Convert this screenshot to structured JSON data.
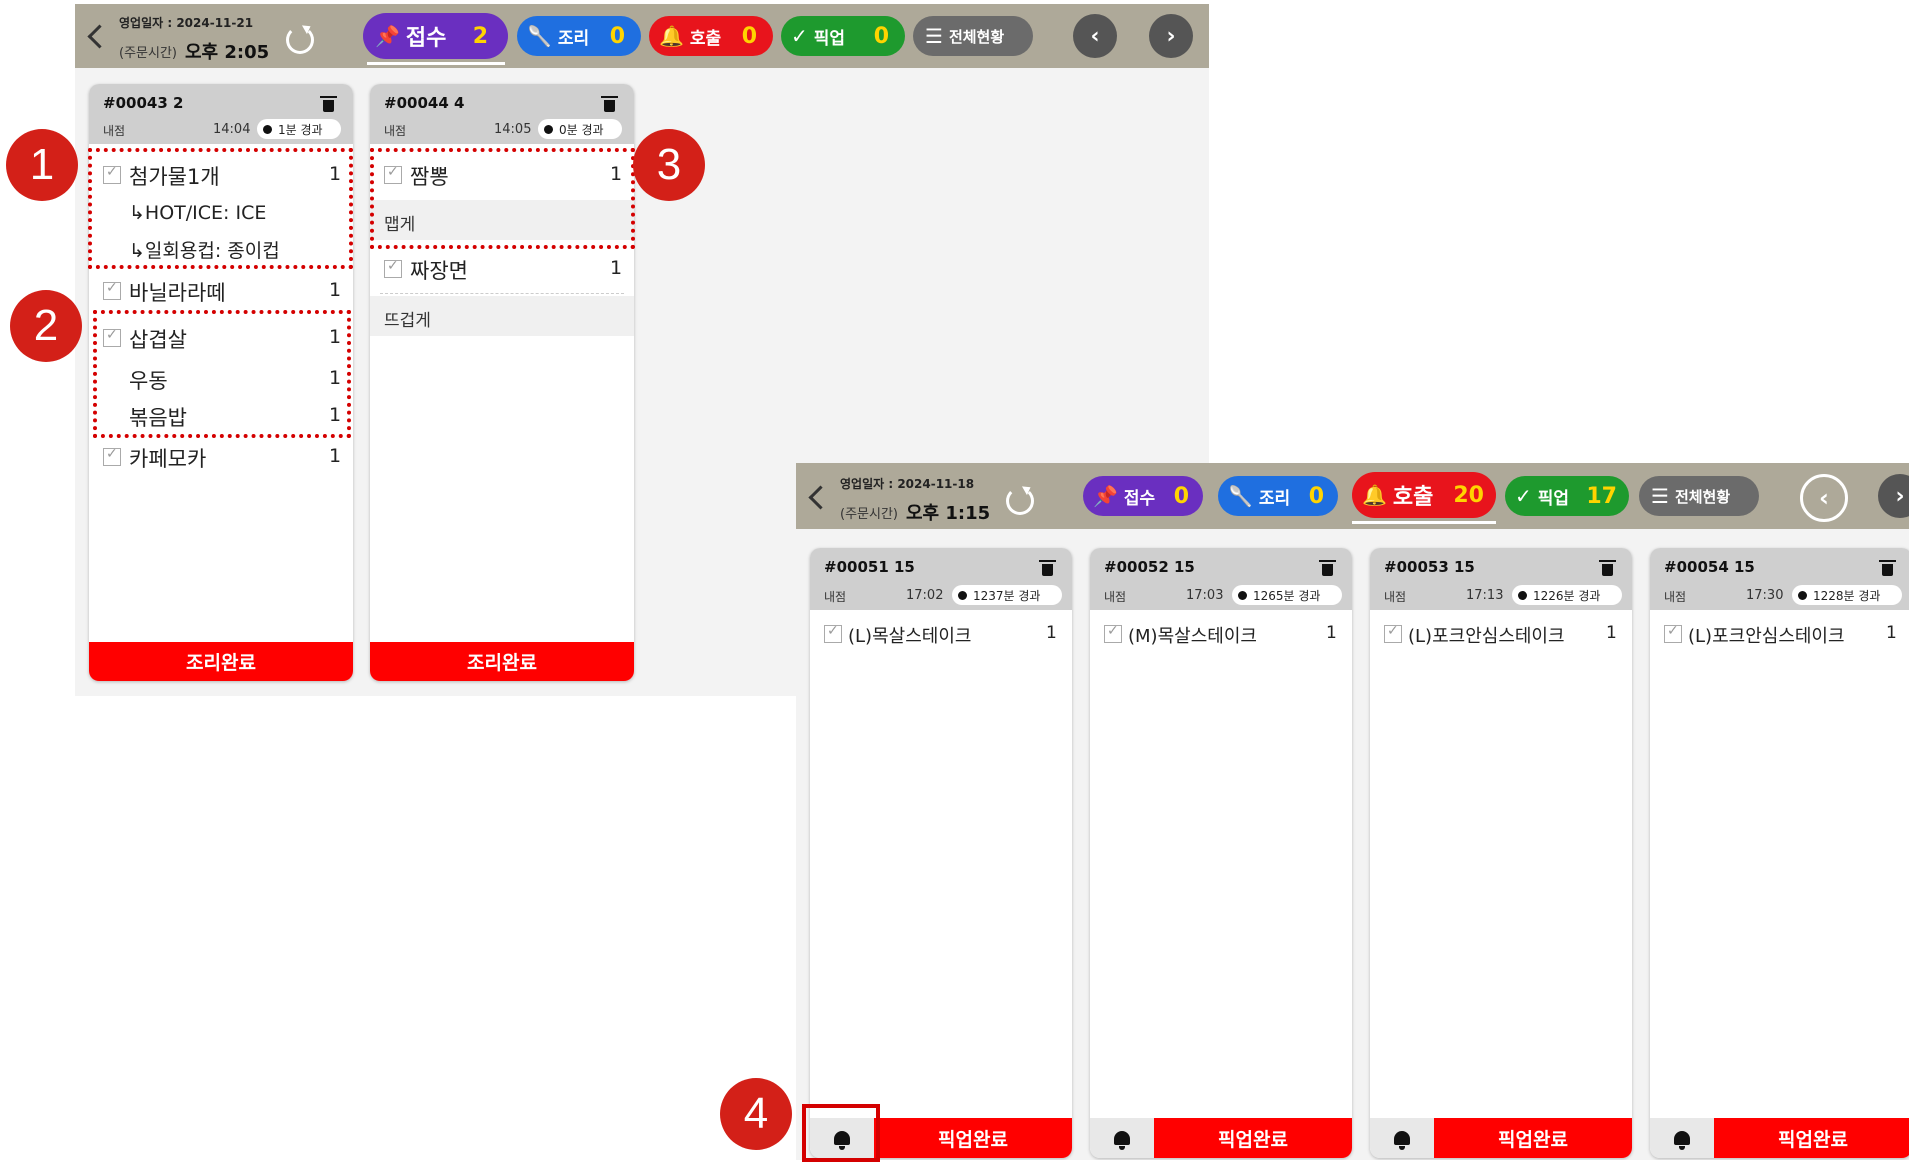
{
  "screen1": {
    "header": {
      "business_date": "영업일자 : 2024-11-21",
      "order_time_label": "(주문시간)",
      "order_time": "오후 2:05"
    },
    "tabs": [
      {
        "icon": "pin-icon",
        "label": "접수",
        "count": "2",
        "color": "#6a2fc0",
        "count_color": "#ffd400",
        "active": true
      },
      {
        "icon": "ladle-icon",
        "label": "조리",
        "count": "0",
        "color": "#1f6fe0",
        "count_color": "#ffd400"
      },
      {
        "icon": "bell-icon",
        "label": "호출",
        "count": "0",
        "color": "#e8141c",
        "count_color": "#ffd400"
      },
      {
        "icon": "check-icon",
        "label": "픽업",
        "count": "0",
        "color": "#1e9a2e",
        "count_color": "#ffd400"
      },
      {
        "icon": "menu-icon",
        "label": "전체현황",
        "color": "#6b6b6b"
      }
    ],
    "cards": [
      {
        "order_no": "#00043  2",
        "store": "내점",
        "time": "14:04",
        "elapsed": "1분 경과",
        "items": [
          {
            "name": "첨가물1개",
            "qty": "1",
            "options": [
              "HOT/ICE: ICE",
              "일회용컵: 종이컵"
            ]
          },
          {
            "name": "바닐라라떼",
            "qty": "1"
          },
          {
            "name": "삽겹살",
            "qty": "1"
          },
          {
            "name": "우동",
            "qty": "1"
          },
          {
            "name": "볶음밥",
            "qty": "1"
          },
          {
            "name": "카페모카",
            "qty": "1"
          }
        ],
        "button": "조리완료"
      },
      {
        "order_no": "#00044  4",
        "store": "내점",
        "time": "14:05",
        "elapsed": "0분 경과",
        "items": [
          {
            "name": "짬뽕",
            "qty": "1",
            "memo": "맵게"
          },
          {
            "name": "짜장면",
            "qty": "1",
            "memo": "뜨겁게"
          }
        ],
        "button": "조리완료"
      }
    ]
  },
  "screen2": {
    "header": {
      "business_date": "영업일자 : 2024-11-18",
      "order_time_label": "(주문시간)",
      "order_time": "오후 1:15"
    },
    "tabs": [
      {
        "icon": "pin-icon",
        "label": "접수",
        "count": "0",
        "color": "#6a2fc0",
        "count_color": "#ffd400"
      },
      {
        "icon": "ladle-icon",
        "label": "조리",
        "count": "0",
        "color": "#1f6fe0",
        "count_color": "#ffd400"
      },
      {
        "icon": "bell-icon",
        "label": "호출",
        "count": "20",
        "color": "#e8141c",
        "count_color": "#ffd400",
        "active": true
      },
      {
        "icon": "check-icon",
        "label": "픽업",
        "count": "17",
        "color": "#1e9a2e",
        "count_color": "#ffd400"
      },
      {
        "icon": "menu-icon",
        "label": "전체현황",
        "color": "#6b6b6b"
      }
    ],
    "cards": [
      {
        "order_no": "#00051  15",
        "store": "내점",
        "time": "17:02",
        "elapsed": "1237분 경과",
        "item": "(L)목살스테이크",
        "qty": "1",
        "button": "픽업완료"
      },
      {
        "order_no": "#00052  15",
        "store": "내점",
        "time": "17:03",
        "elapsed": "1265분 경과",
        "item": "(M)목살스테이크",
        "qty": "1",
        "button": "픽업완료"
      },
      {
        "order_no": "#00053  15",
        "store": "내점",
        "time": "17:13",
        "elapsed": "1226분 경과",
        "item": "(L)포크안심스테이크",
        "qty": "1",
        "button": "픽업완료"
      },
      {
        "order_no": "#00054  15",
        "store": "내점",
        "time": "17:30",
        "elapsed": "1228분 경과",
        "item": "(L)포크안심스테이크",
        "qty": "1",
        "button": "픽업완료"
      }
    ]
  },
  "markers": [
    "1",
    "2",
    "3",
    "4"
  ]
}
